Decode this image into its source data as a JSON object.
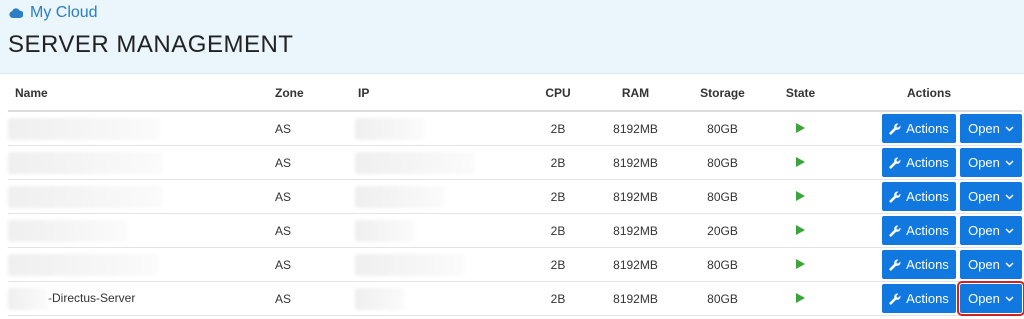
{
  "breadcrumb": {
    "label": "My Cloud"
  },
  "page": {
    "title": "SERVER MANAGEMENT"
  },
  "table": {
    "headers": {
      "name": "Name",
      "zone": "Zone",
      "ip": "IP",
      "cpu": "CPU",
      "ram": "RAM",
      "storage": "Storage",
      "state": "State",
      "actions": "Actions"
    },
    "rows": [
      {
        "name": "",
        "zone": "AS",
        "ip": "",
        "cpu": "2B",
        "ram": "8192MB",
        "storage": "80GB",
        "state": "running"
      },
      {
        "name": "",
        "zone": "AS",
        "ip": "",
        "cpu": "2B",
        "ram": "8192MB",
        "storage": "80GB",
        "state": "running"
      },
      {
        "name": "",
        "zone": "AS",
        "ip": "",
        "cpu": "2B",
        "ram": "8192MB",
        "storage": "80GB",
        "state": "running"
      },
      {
        "name": "",
        "zone": "AS",
        "ip": "",
        "cpu": "2B",
        "ram": "8192MB",
        "storage": "20GB",
        "state": "running"
      },
      {
        "name": "",
        "zone": "AS",
        "ip": "",
        "cpu": "2B",
        "ram": "8192MB",
        "storage": "80GB",
        "state": "running"
      },
      {
        "name": "-Directus-Server",
        "zone": "AS",
        "ip": "",
        "cpu": "2B",
        "ram": "8192MB",
        "storage": "80GB",
        "state": "running"
      }
    ],
    "actions_label": "Actions",
    "open_label": "Open"
  },
  "colors": {
    "accent": "#1178df",
    "header_bg": "#eaf5fc",
    "state_running": "#3aa53a",
    "highlight": "#d62020"
  },
  "icons": {
    "breadcrumb": "cloud-icon",
    "actions": "wrench-icon",
    "open": "chevron-down-icon",
    "state": "play-icon"
  }
}
